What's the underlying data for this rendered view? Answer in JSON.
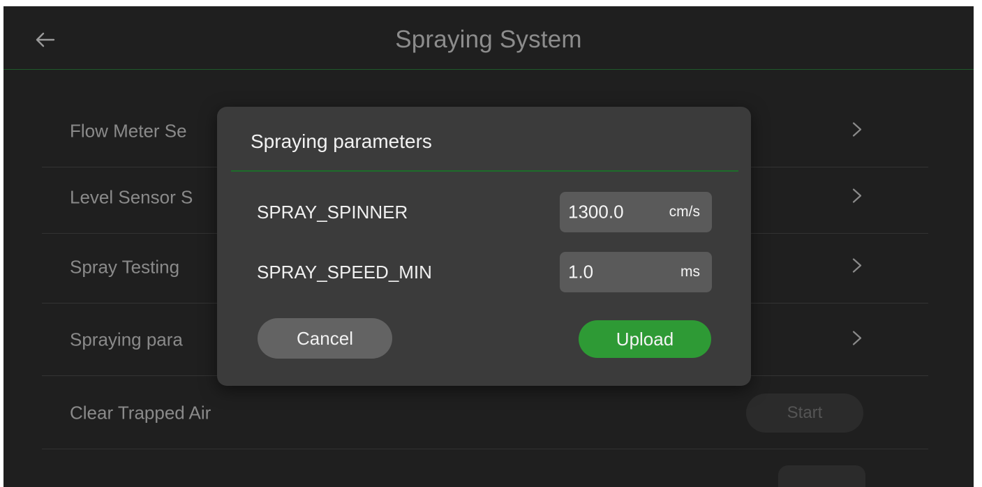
{
  "app": {
    "title": "Spraying System"
  },
  "menu": {
    "items": [
      {
        "label": "Flow Meter Se",
        "chevron": ">"
      },
      {
        "label": "Level Sensor S",
        "chevron": ">"
      },
      {
        "label": "Spray Testing",
        "chevron": ">"
      },
      {
        "label": "Spraying para",
        "chevron": ">"
      },
      {
        "label": "Clear Trapped Air",
        "button": "Start"
      }
    ]
  },
  "dialog": {
    "title": "Spraying parameters",
    "params": [
      {
        "label": "SPRAY_SPINNER",
        "value": "1300.0",
        "unit": "cm/s"
      },
      {
        "label": "SPRAY_SPEED_MIN",
        "value": "1.0",
        "unit": "ms"
      }
    ],
    "cancel_label": "Cancel",
    "upload_label": "Upload"
  },
  "colors": {
    "background": "#1f1f1f",
    "accent": "#2e9a35",
    "divider": "#1d6d2a",
    "dialog": "#3b3b3b"
  },
  "icons": {
    "back": "arrow-left-icon",
    "chevron": "chevron-right-icon"
  }
}
